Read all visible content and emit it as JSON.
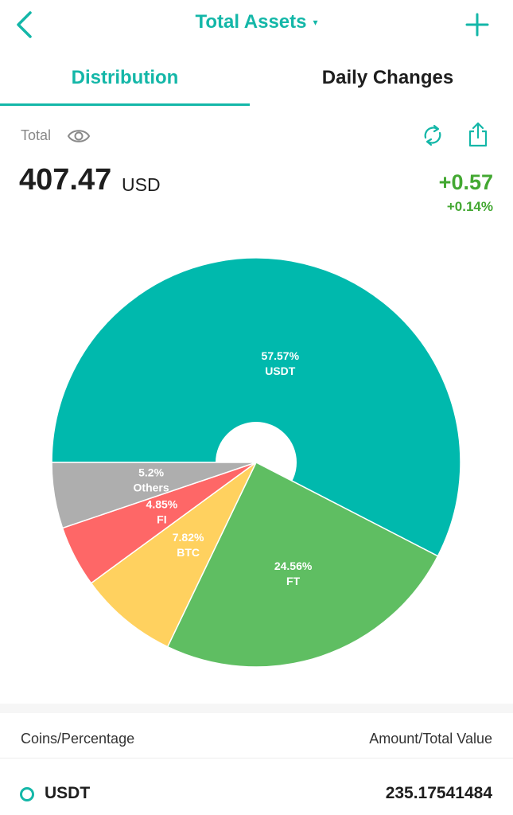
{
  "header": {
    "title": "Total Assets",
    "caret": "▾"
  },
  "tabs": [
    {
      "label": "Distribution",
      "active": true
    },
    {
      "label": "Daily Changes",
      "active": false
    }
  ],
  "summary": {
    "total_label": "Total",
    "total_value": "407.47",
    "currency": "USD",
    "change_abs": "+0.57",
    "change_pct": "+0.14%"
  },
  "colors": {
    "accent": "#14b7a8",
    "positive": "#43a832"
  },
  "chart_data": {
    "type": "pie",
    "slices": [
      {
        "name": "USDT",
        "percent_label": "57.57%",
        "value": 57.57,
        "color": "#00b9ad"
      },
      {
        "name": "FT",
        "percent_label": "24.56%",
        "value": 24.56,
        "color": "#5fbe62"
      },
      {
        "name": "BTC",
        "percent_label": "7.82%",
        "value": 7.82,
        "color": "#ffd15f"
      },
      {
        "name": "FI",
        "percent_label": "4.85%",
        "value": 4.85,
        "color": "#fe6767"
      },
      {
        "name": "Others",
        "percent_label": "5.2%",
        "value": 5.2,
        "color": "#aeaeae"
      }
    ]
  },
  "list": {
    "col_left": "Coins/Percentage",
    "col_right": "Amount/Total Value",
    "rows": [
      {
        "coin": "USDT",
        "amount": "235.17541484"
      }
    ]
  },
  "icons": [
    "chevron-left-icon",
    "plus-icon",
    "eye-icon",
    "refresh-icon",
    "share-icon"
  ]
}
